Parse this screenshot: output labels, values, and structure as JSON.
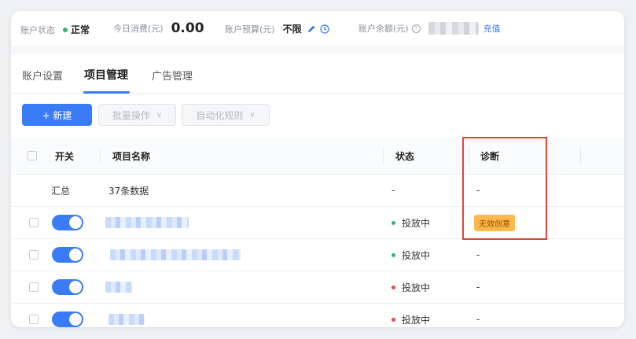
{
  "status": {
    "account_state_label": "账户状态",
    "account_state_value": "正常",
    "today_spend_label": "今日消费(元)",
    "today_spend_value": "0.00",
    "budget_label": "账户预算(元)",
    "budget_value": "不限",
    "balance_label": "账户余额(元)",
    "recharge_label": "充值",
    "help_icon": "?"
  },
  "tabs": [
    {
      "label": "账户设置"
    },
    {
      "label": "项目管理",
      "active": true
    },
    {
      "label": "广告管理"
    }
  ],
  "toolbar": {
    "new_label": "+ 新建",
    "batch_label": "批量操作",
    "auto_rule_label": "自动化规则"
  },
  "table": {
    "headers": {
      "switch": "开关",
      "name": "项目名称",
      "status": "状态",
      "diagnosis": "诊断"
    },
    "summary": {
      "label": "汇总",
      "name": "37条数据",
      "status": "-",
      "diagnosis": "-"
    },
    "rows": [
      {
        "status": "投放中",
        "status_color": "#2bb673",
        "diagnosis": "无效创意"
      },
      {
        "status": "投放中",
        "status_color": "#2bb673",
        "diagnosis": "-"
      },
      {
        "status": "投放中",
        "status_color": "#ef4b4b",
        "diagnosis": "-"
      },
      {
        "status": "投放中",
        "status_color": "#ef4b4b",
        "diagnosis": "-"
      }
    ]
  },
  "colors": {
    "accent": "#3a7cf6",
    "highlight": "#e0453a",
    "badge": "#ffb84d"
  }
}
